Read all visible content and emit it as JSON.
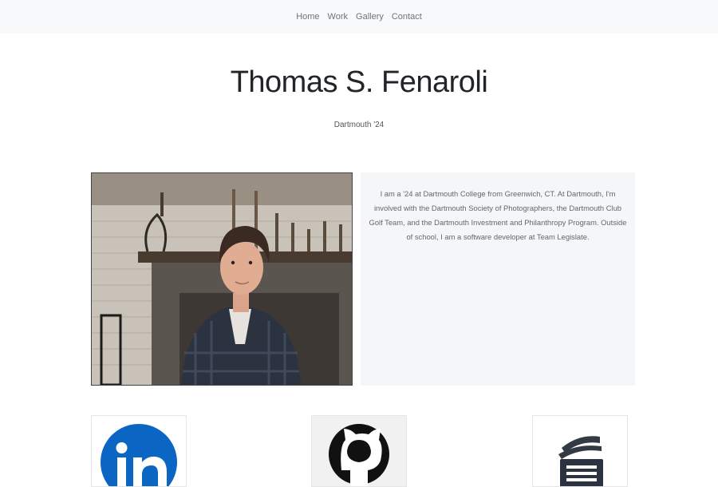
{
  "nav": {
    "items": [
      "Home",
      "Work",
      "Gallery",
      "Contact"
    ]
  },
  "header": {
    "title": "Thomas S. Fenaroli",
    "subtitle": "Dartmouth '24"
  },
  "bio": {
    "text": "I am a '24 at Dartmouth College from Greenwich, CT. At Dartmouth, I'm involved with the Dartmouth Society of Photographers, the Dartmouth Club Golf Team, and the Dartmouth Investment and Philanthropy Program. Outside of school, I am a software developer at Team Legislate."
  },
  "social": {
    "icons": [
      "linkedin-icon",
      "github-icon",
      "document-icon"
    ]
  },
  "colors": {
    "navbar_bg": "#f8f9fa",
    "bio_bg": "#f5f6f8",
    "linkedin_blue": "#0a66c2"
  }
}
